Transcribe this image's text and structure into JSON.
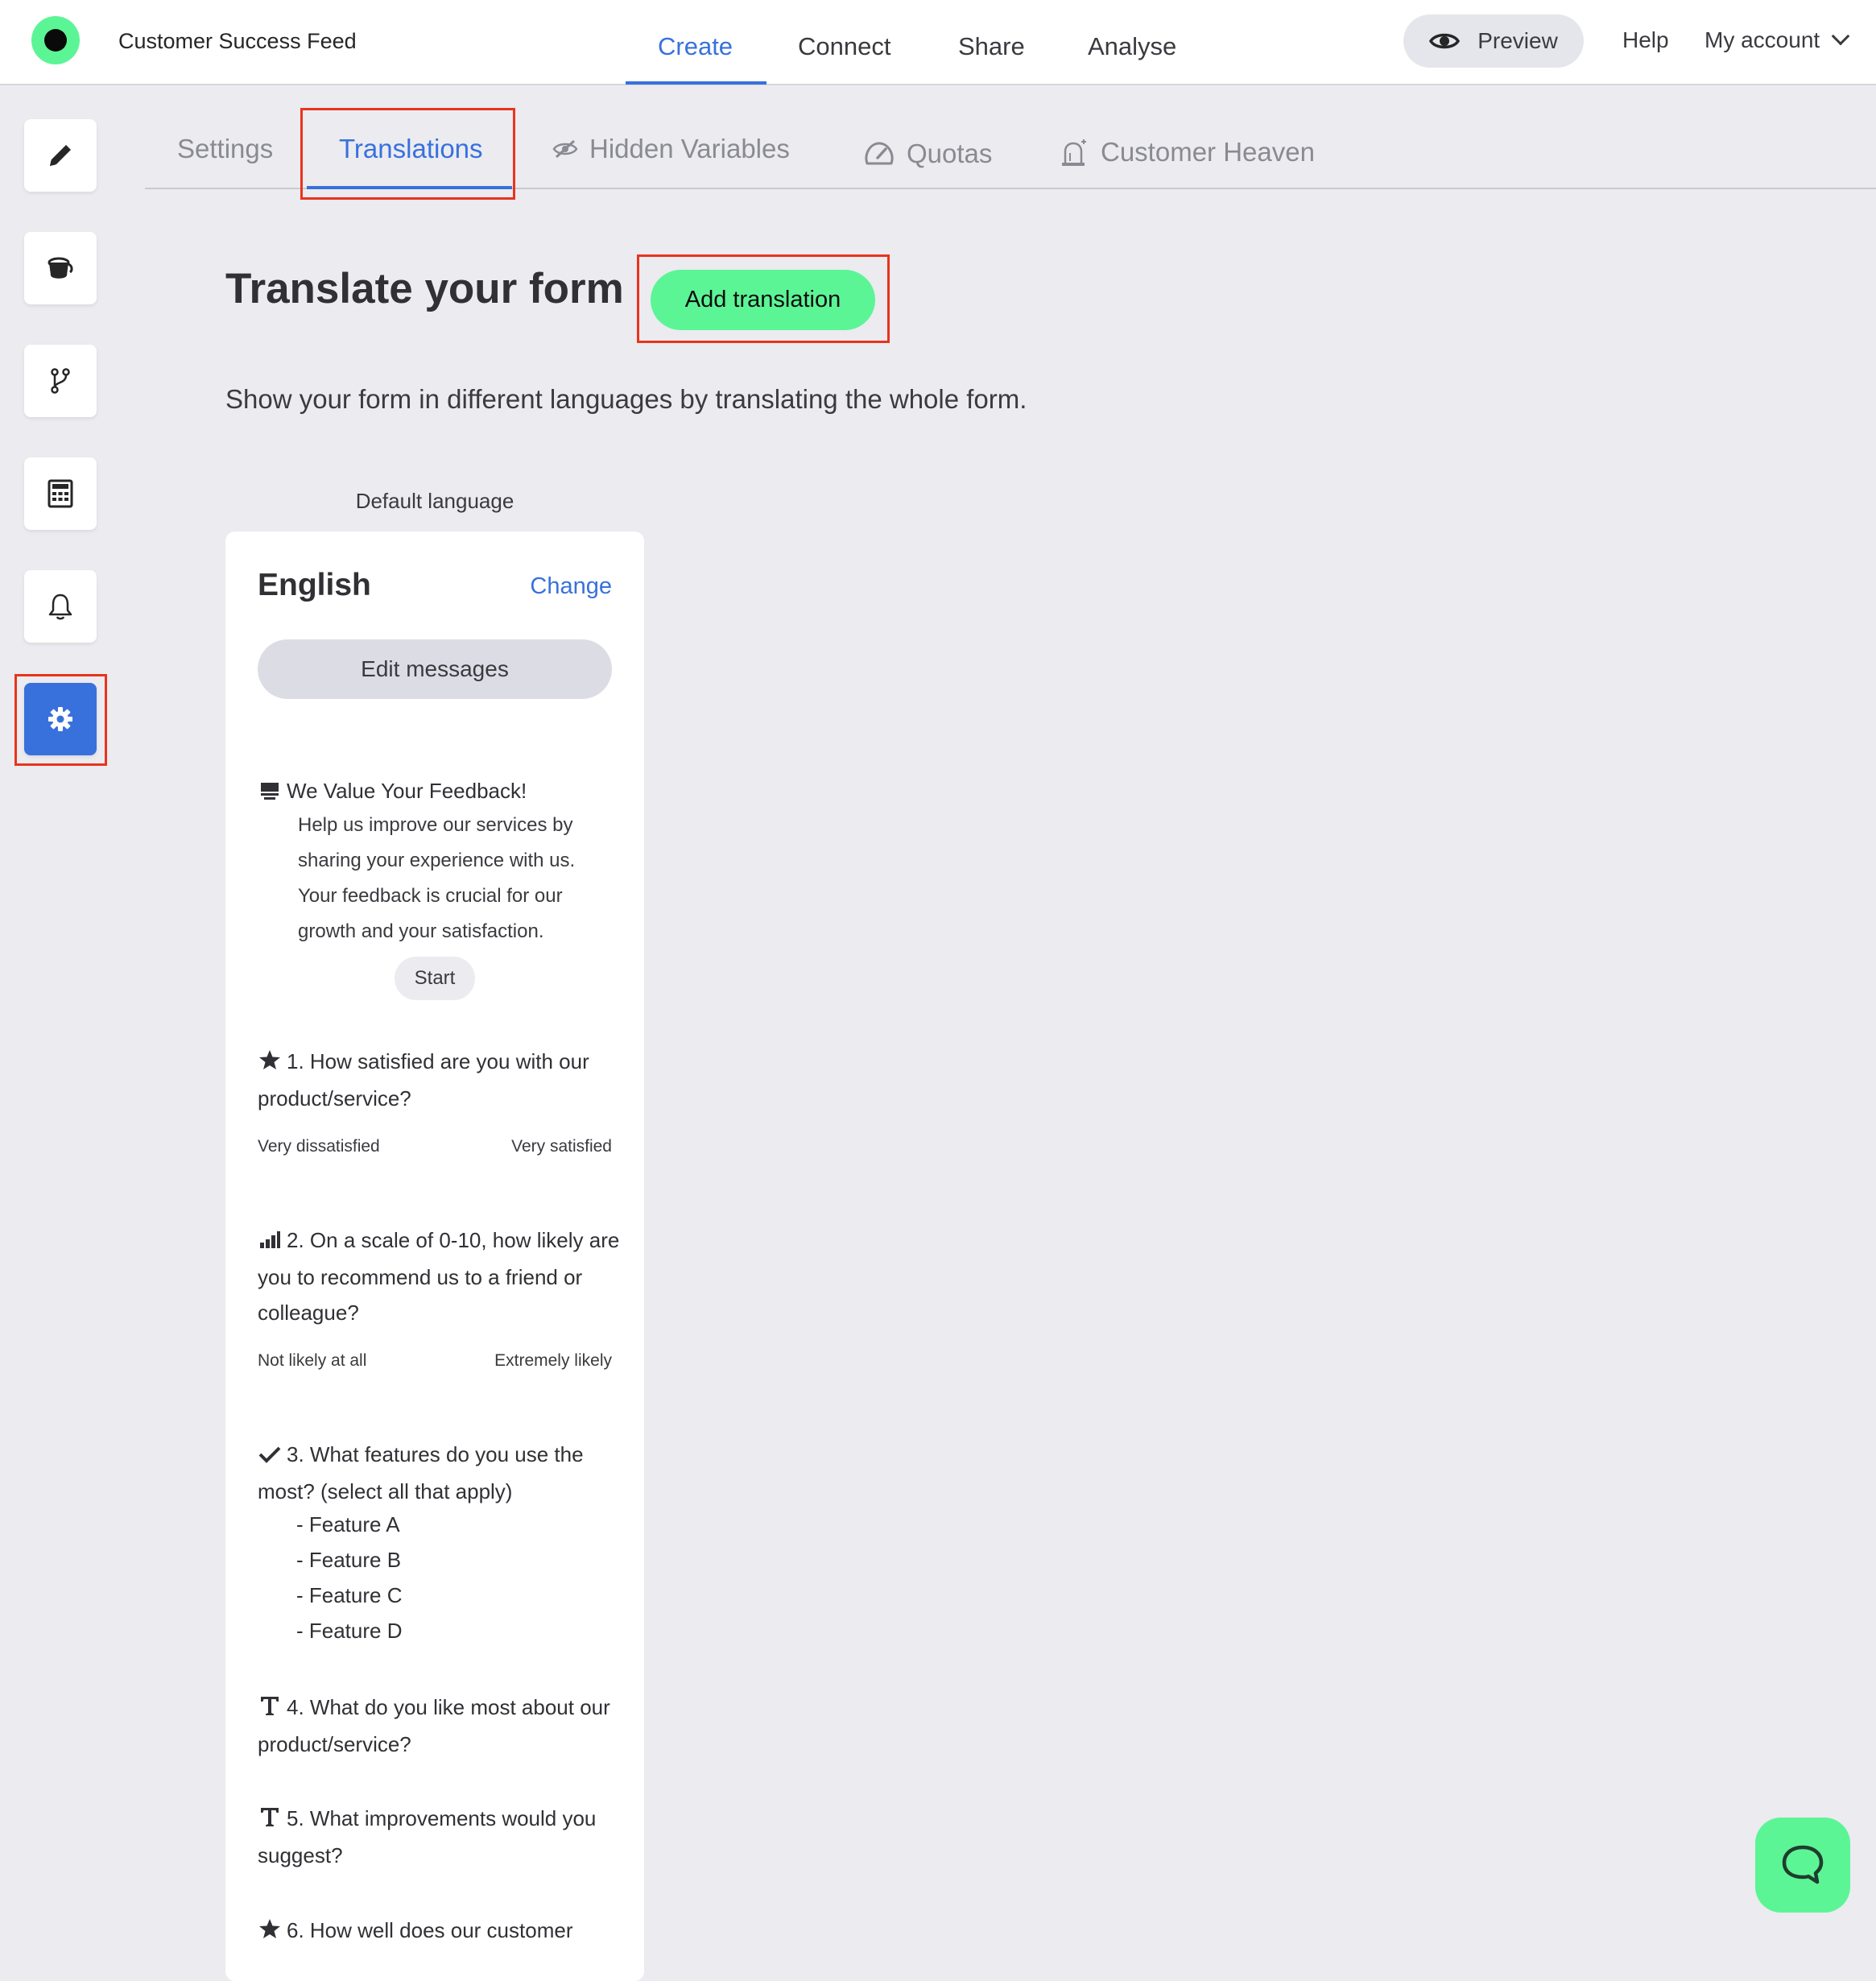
{
  "header": {
    "form_name": "Customer Success Feed",
    "nav": [
      "Create",
      "Connect",
      "Share",
      "Analyse"
    ],
    "active_nav": "Create",
    "preview_label": "Preview",
    "help_label": "Help",
    "account_label": "My account"
  },
  "sidebar": {
    "items": [
      {
        "icon": "pencil-icon"
      },
      {
        "icon": "paint-bucket-icon"
      },
      {
        "icon": "branch-icon"
      },
      {
        "icon": "calculator-icon"
      },
      {
        "icon": "bell-icon"
      },
      {
        "icon": "gear-icon",
        "active": true
      }
    ]
  },
  "subtabs": [
    {
      "label": "Settings"
    },
    {
      "label": "Translations",
      "active": true
    },
    {
      "label": "Hidden Variables",
      "icon": "eye-slash-icon"
    },
    {
      "label": "Quotas",
      "icon": "gauge-icon"
    },
    {
      "label": "Customer Heaven",
      "icon": "alarm-icon"
    }
  ],
  "main": {
    "title": "Translate your form",
    "add_button": "Add translation",
    "description": "Show your form in different languages by translating the whole form.",
    "default_language_label": "Default language"
  },
  "card": {
    "language": "English",
    "change_label": "Change",
    "edit_messages": "Edit messages",
    "welcome": {
      "title": "We Value Your Feedback!",
      "lines": [
        "Help us improve our services by",
        "sharing your experience with us.",
        "Your feedback is crucial for our",
        "growth and your satisfaction."
      ],
      "start": "Start"
    },
    "questions": [
      {
        "icon": "star-icon",
        "text": "1. How satisfied are you with our product/service?",
        "left": "Very dissatisfied",
        "right": "Very satisfied"
      },
      {
        "icon": "bar-chart-icon",
        "text": "2. On a scale of 0-10, how likely are you to recommend us to a friend or colleague?",
        "left": "Not likely at all",
        "right": "Extremely likely"
      },
      {
        "icon": "check-icon",
        "text": "3. What features do you use the most? (select all that apply)",
        "choices": [
          "- Feature A",
          "- Feature B",
          "- Feature C",
          "- Feature D"
        ]
      },
      {
        "icon": "text-icon",
        "text": "4. What do you like most about our product/service?"
      },
      {
        "icon": "text-icon",
        "text": "5. What improvements would you suggest?"
      },
      {
        "icon": "star-icon",
        "text": "6. How well does our customer"
      }
    ]
  },
  "colors": {
    "accent": "#3871dc",
    "brand_green": "#5cf596",
    "highlight_red": "#e8341c",
    "background": "#ebebf0"
  }
}
